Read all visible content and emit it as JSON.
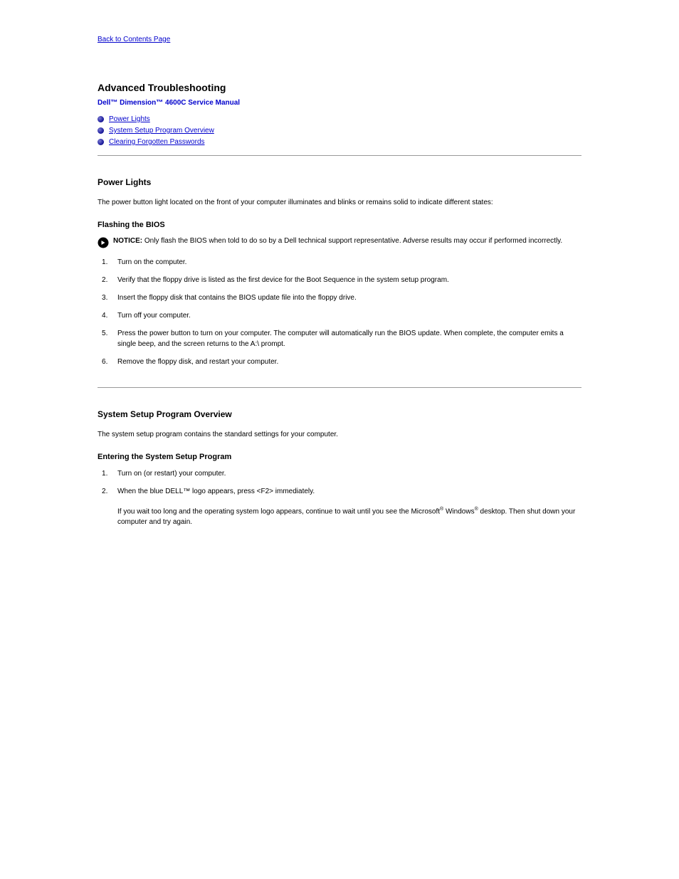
{
  "nav": {
    "back_link": "Back to Contents Page"
  },
  "header": {
    "section_title": "Advanced Troubleshooting",
    "doc_title": "Dell™ Dimension™ 4600C Service Manual"
  },
  "toc": [
    {
      "label": "Power Lights"
    },
    {
      "label": "System Setup Program Overview"
    },
    {
      "label": "Clearing Forgotten Passwords"
    }
  ],
  "power_lights": {
    "title": "Power Lights",
    "para1": "The power button light located on the front of your computer illuminates and blinks or remains solid to indicate different states:",
    "sub_heading": "Flashing the BIOS",
    "notice_label": "NOTICE:",
    "notice_text": " Only flash the BIOS when told to do so by a Dell technical support representative. Adverse results may occur if performed incorrectly.",
    "list": [
      "Turn on the computer.",
      "Verify that the floppy drive is listed as the first device for the Boot Sequence in the system setup program.",
      "Insert the floppy disk that contains the BIOS update file into the floppy drive.",
      "Turn off your computer.",
      "Press the power button to turn on your computer. The computer will automatically run the BIOS update. When complete, the computer emits a single beep, and the screen returns to the A:\\ prompt.",
      "Remove the floppy disk, and restart your computer."
    ]
  },
  "system_setup": {
    "title": "System Setup Program Overview",
    "para1": "The system setup program contains the standard settings for your computer.",
    "entering_heading": "Entering the System Setup Program",
    "list": [
      {
        "text": "Turn on (or restart) your computer."
      },
      {
        "text": "When the blue DELL™ logo appears, press <F2> immediately.",
        "nested": "If you wait too long and the operating system logo appears, continue to wait until you see the Microsoft® Windows® desktop. Then shut down your computer and try again."
      }
    ]
  }
}
